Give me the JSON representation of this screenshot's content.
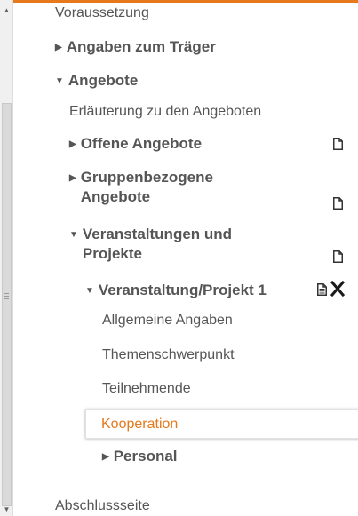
{
  "colors": {
    "accent": "#e5791c",
    "text": "#555555",
    "active_text": "#e5791c"
  },
  "nav": {
    "voraussetzung": "Voraussetzung",
    "angaben_traeger": "Angaben zum Träger",
    "angebote": "Angebote",
    "erlaeuterung": "Erläuterung zu den Angeboten",
    "offene_angebote": "Offene Angebote",
    "gruppenbezogene_line1": "Gruppenbezogene",
    "gruppenbezogene_line2": "Angebote",
    "veranstaltungen_line1": "Veranstaltungen und",
    "veranstaltungen_line2": "Projekte",
    "veranstaltung_projekt": "Veranstaltung/Projekt 1",
    "allgemeine_angaben": "Allgemeine Angaben",
    "themenschwerpunkt": "Themenschwerpunkt",
    "teilnehmende": "Teilnehmende",
    "kooperation": "Kooperation",
    "personal": "Personal",
    "abschlussseite": "Abschlussseite"
  },
  "icons": {
    "expand": "triangle-right-icon",
    "collapse": "triangle-down-icon",
    "add_document": "document-icon",
    "edit_document": "document-lines-icon",
    "delete": "close-x-icon"
  }
}
